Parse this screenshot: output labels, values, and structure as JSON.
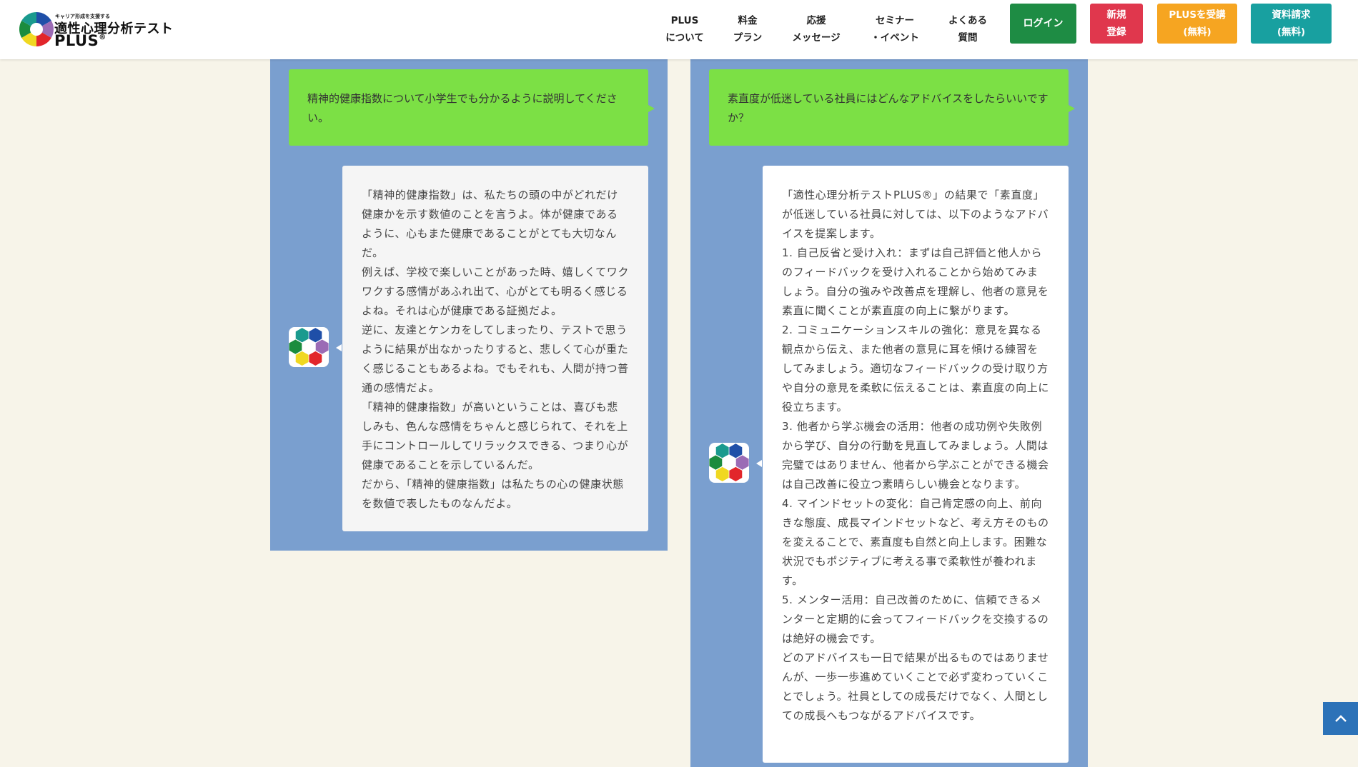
{
  "colors": {
    "background": "#f7f4e9",
    "panel": "#7a9fcf",
    "question_bubble": "#7ce045",
    "login_green": "#1e8c44",
    "register_red": "#e0374d",
    "trial_orange": "#f6a521",
    "docs_teal": "#18a0a0",
    "back_to_top": "#2c72b8"
  },
  "header": {
    "logo": {
      "tagline": "キャリア形成を支援する",
      "title": "適性心理分析テスト",
      "plus": "PLUS",
      "registered": "®",
      "icon": "hexagon-flower-logo"
    },
    "nav": [
      {
        "line1": "PLUS",
        "line2": "について"
      },
      {
        "line1": "料金",
        "line2": "プラン"
      },
      {
        "line1": "応援",
        "line2": "メッセージ"
      },
      {
        "line1": "セミナー",
        "line2": "・イベント"
      },
      {
        "line1": "よくある",
        "line2": "質問"
      }
    ],
    "buttons": {
      "login": "ログイン",
      "register": {
        "line1": "新規",
        "line2": "登録"
      },
      "trial": {
        "line1": "PLUSを受講",
        "line2": "(無料)"
      },
      "docs": {
        "line1": "資料請求",
        "line2": "(無料)"
      }
    }
  },
  "chats": [
    {
      "question": "精神的健康指数について小学生でも分かるように説明してください。",
      "answer": [
        "「精神的健康指数」は、私たちの頭の中がどれだけ健康かを示す数値のことを言うよ。体が健康であるように、心もまた健康であることがとても大切なんだ。",
        "例えば、学校で楽しいことがあった時、嬉しくてワクワクする感情があふれ出て、心がとても明るく感じるよね。それは心が健康である証拠だよ。",
        "逆に、友達とケンカをしてしまったり、テストで思うように結果が出なかったりすると、悲しくて心が重たく感じることもあるよね。でもそれも、人間が持つ普通の感情だよ。",
        "「精神的健康指数」が高いということは、喜びも悲しみも、色んな感情をちゃんと感じられて、それを上手にコントロールしてリラックスできる、つまり心が健康であることを示しているんだ。",
        "だから、「精神的健康指数」は私たちの心の健康状態を数値で表したものなんだよ。"
      ],
      "avatar_icon": "hexagon-flower-avatar-icon"
    },
    {
      "question": "素直度が低迷している社員にはどんなアドバイスをしたらいいですか？",
      "answer": [
        "「適性心理分析テストPLUS®」の結果で「素直度」が低迷している社員に対しては、以下のようなアドバイスを提案します。",
        "1. 自己反省と受け入れ：まずは自己評価と他人からのフィードバックを受け入れることから始めてみましょう。自分の強みや改善点を理解し、他者の意見を素直に聞くことが素直度の向上に繋がります。",
        "2. コミュニケーションスキルの強化：意見を異なる観点から伝え、また他者の意見に耳を傾ける練習をしてみましょう。適切なフィードバックの受け取り方や自分の意見を柔軟に伝えることは、素直度の向上に役立ちます。",
        "3. 他者から学ぶ機会の活用：他者の成功例や失敗例から学び、自分の行動を見直してみましょう。人間は完璧ではありません、他者から学ぶことができる機会は自己改善に役立つ素晴らしい機会となります。",
        "4. マインドセットの変化：自己肯定感の向上、前向きな態度、成長マインドセットなど、考え方そのものを変えることで、素直度も自然と向上します。困難な状況でもポジティブに考える事で柔軟性が養われます。",
        "5. メンター活用：自己改善のために、信頼できるメンターと定期的に会ってフィードバックを交換するのは絶好の機会です。",
        "どのアドバイスも一日で結果が出るものではありませんが、一歩一歩進めていくことで必ず変わっていくことでしょう。社員としての成長だけでなく、人間としての成長へもつながるアドバイスです。"
      ],
      "avatar_icon": "hexagon-flower-avatar-icon"
    }
  ],
  "back_to_top_icon": "chevron-up-icon"
}
